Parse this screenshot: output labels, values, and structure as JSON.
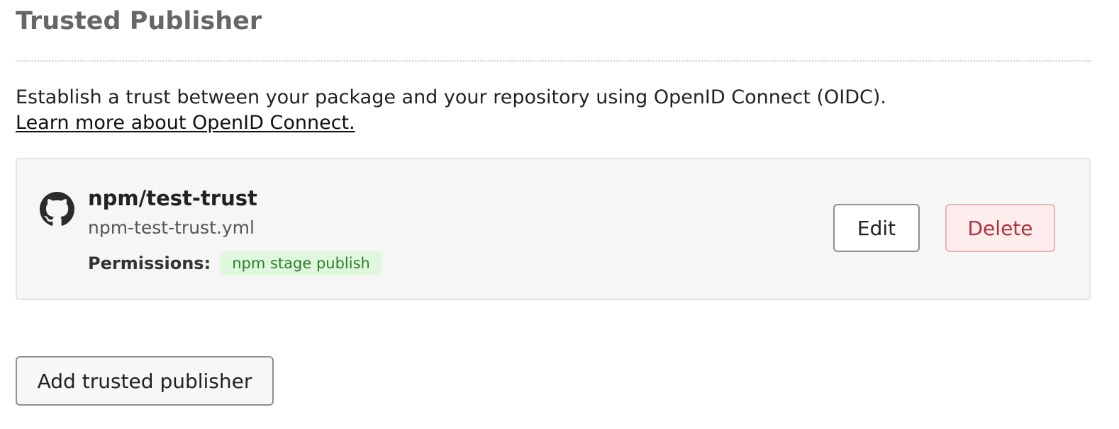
{
  "section": {
    "title": "Trusted Publisher",
    "description": "Establish a trust between your package and your repository using OpenID Connect (OIDC).",
    "learn_more_link": "Learn more about OpenID Connect."
  },
  "publisher": {
    "provider_icon": "github-icon",
    "repository": "npm/test-trust",
    "workflow_file": "npm-test-trust.yml",
    "permissions_label": "Permissions:",
    "permissions": [
      "npm stage publish"
    ],
    "edit_label": "Edit",
    "delete_label": "Delete"
  },
  "actions": {
    "add_label": "Add trusted publisher"
  },
  "colors": {
    "badge_text": "#2e7d2e",
    "badge_background": "#dff7dc",
    "delete_text": "#b2323c",
    "delete_background": "#fdeded"
  }
}
